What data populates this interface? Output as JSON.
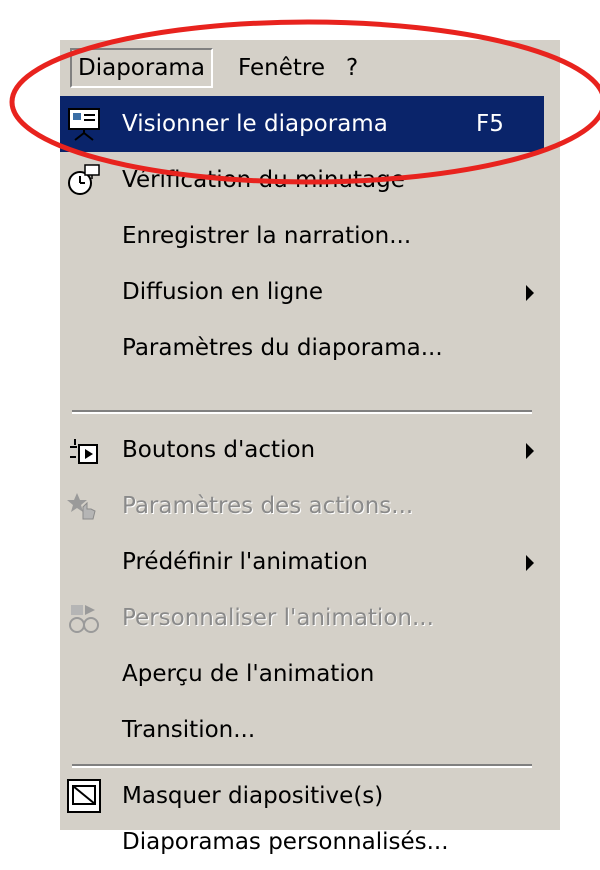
{
  "menubar": {
    "items": [
      {
        "label": "Diaporama",
        "open": true
      },
      {
        "label": "Fenêtre",
        "open": false
      },
      {
        "label": "?",
        "open": false
      }
    ]
  },
  "menu": {
    "items": [
      {
        "label": "Visionner le diaporama",
        "shortcut": "F5",
        "icon": "slideshow-projector-icon",
        "selected": true
      },
      {
        "label": "Vérification du minutage",
        "icon": "rehearse-timings-icon"
      },
      {
        "label": "Enregistrer la narration..."
      },
      {
        "label": "Diffusion en ligne",
        "submenu": true
      },
      {
        "label": "Paramètres du diaporama..."
      },
      {
        "label": "Boutons d'action",
        "icon": "action-buttons-icon",
        "submenu": true
      },
      {
        "label": "Paramètres des actions...",
        "icon": "action-settings-icon",
        "disabled": true
      },
      {
        "label": "Prédéfinir l'animation",
        "submenu": true
      },
      {
        "label": "Personnaliser l'animation...",
        "icon": "custom-animation-icon",
        "disabled": true
      },
      {
        "label": "Aperçu de l'animation"
      },
      {
        "label": "Transition..."
      },
      {
        "label": "Masquer diapositive(s)",
        "icon": "hide-slide-icon"
      },
      {
        "label": "Diaporamas personnalisés..."
      }
    ]
  },
  "colors": {
    "menu_background": "#d4d0c8",
    "highlight": "#0a246a",
    "highlight_text": "#ffffff",
    "disabled_text": "#8a8a8a",
    "annotation": "#e8231e"
  }
}
